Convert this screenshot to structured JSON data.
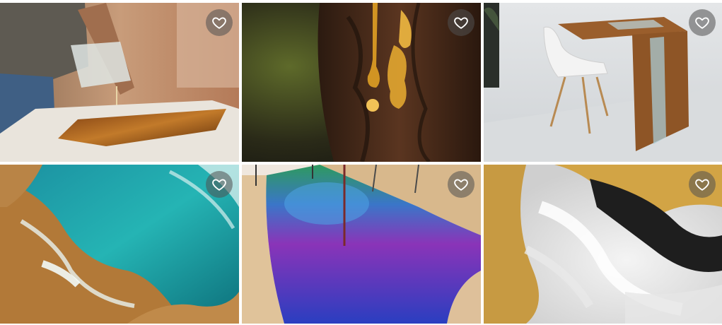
{
  "gallery": {
    "items": [
      {
        "name": "photo-resin-pouring-table",
        "favorite": false
      },
      {
        "name": "photo-tree-sap-drops",
        "favorite": false
      },
      {
        "name": "photo-resin-river-desk-chair",
        "favorite": false
      },
      {
        "name": "photo-teal-gold-resin-art",
        "favorite": false
      },
      {
        "name": "photo-purple-blue-river-table",
        "favorite": false
      },
      {
        "name": "photo-gold-black-white-resin-swirl",
        "favorite": false
      }
    ]
  },
  "icons": {
    "favorite": "heart-outline-icon"
  },
  "colors": {
    "favorite_button_bg": "#505050",
    "favorite_icon": "#ffffff"
  }
}
